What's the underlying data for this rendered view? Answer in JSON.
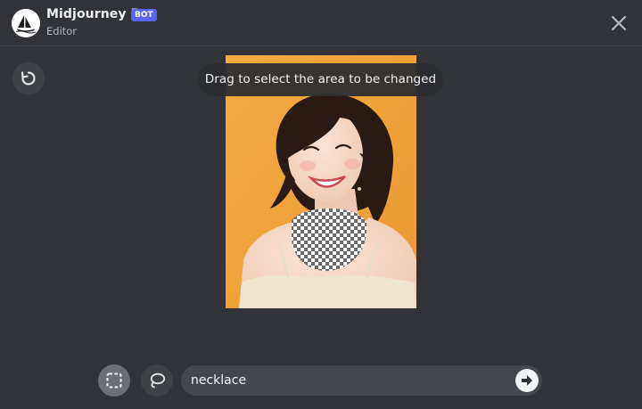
{
  "header": {
    "bot_name": "Midjourney Bot",
    "badge": "BOT",
    "subtitle": "Editor"
  },
  "icons": {
    "avatar": "midjourney-sailboat-logo",
    "close": "close-icon",
    "undo": "undo-icon",
    "rect_select": "rectangle-select-icon",
    "lasso": "lasso-icon",
    "submit": "arrow-right-icon"
  },
  "editor": {
    "hint": "Drag to select the area to be changed"
  },
  "prompt": {
    "value": "necklace"
  },
  "colors": {
    "background": "#313338",
    "badge": "#5865f2",
    "image_background": "#f0a23e",
    "active_tool": "#6d6f78",
    "tool": "#3f4147",
    "input": "#45474e"
  }
}
